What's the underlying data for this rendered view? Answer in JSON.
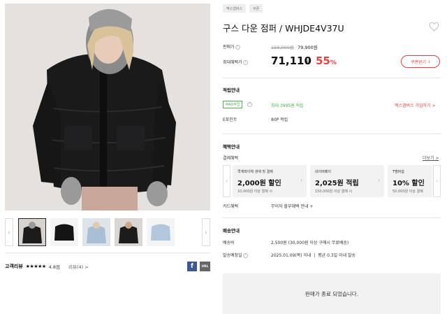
{
  "tags": [
    "멕스앱버스",
    "쿠폰"
  ],
  "product": {
    "title": "구스 다운 점퍼 / WHJDE4V37U",
    "sale_price_label": "판매가",
    "original_price": "159,000원",
    "current_price": "79,900원",
    "best_price_label": "최대혜택가",
    "best_price": "71,110",
    "best_price_unit": "원",
    "discount_value": "55",
    "discount_unit": "%",
    "coupon_button": "쿠폰받기"
  },
  "points": {
    "section_title": "적립안내",
    "max_badge": "MAX적립",
    "max_text": "최대 3995원 적립",
    "join_link": "멕스앱버스 가입하기 >",
    "epoint_label": "E포인트",
    "epoint_value": "80P 적립"
  },
  "benefits": {
    "section_title": "혜택안내",
    "payment_label": "결제혜택",
    "more_link": "더보기 >",
    "cards": [
      {
        "title": "쿡계좌이체 생애 첫 결제",
        "main": "2,000원 할인",
        "sub": "10,000원 이상 결제 시"
      },
      {
        "title": "네이버페이",
        "main": "2,025원 적립",
        "sub": "150,000원 이상 결제 시"
      },
      {
        "title": "T멤버쉽",
        "main": "10% 할인",
        "sub": "50,000원 이상 결제"
      }
    ],
    "card_label": "카드혜택",
    "card_value": "무이자 할부혜택 안내"
  },
  "shipping": {
    "section_title": "배송안내",
    "fee_label": "배송비",
    "fee_value": "2,500원 (30,000원 이상 구매시 무료배송)",
    "date_label": "발송예정일",
    "date_value": "2025.01.09(목) 이내  |  평균 0.3일 이내 발송"
  },
  "soldout_text": "판매가 종료 되었습니다.",
  "reviews": {
    "label": "고객리뷰",
    "stars": "★★★★★",
    "score": "4.8점",
    "count": "리뷰(4) >"
  },
  "share": {
    "facebook": "f",
    "url": "URL"
  },
  "colors": {
    "accent_red": "#e94040",
    "accent_green": "#4caf50"
  }
}
